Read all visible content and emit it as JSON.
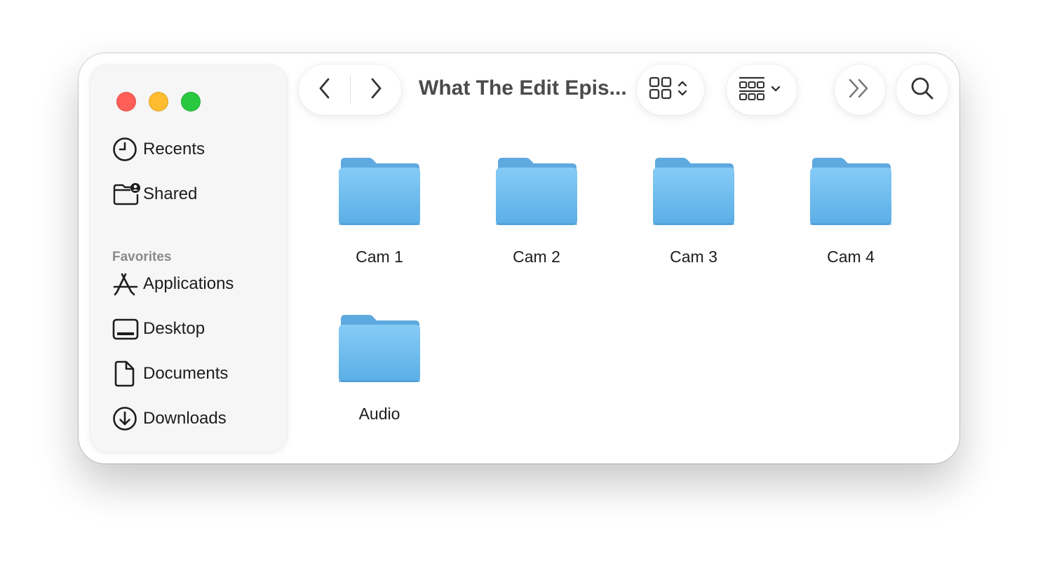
{
  "window": {
    "title": "What The Edit Epis..."
  },
  "sidebar": {
    "top_items": [
      {
        "label": "Recents",
        "icon": "clock-icon"
      },
      {
        "label": "Shared",
        "icon": "shared-folder-icon"
      }
    ],
    "favorites_heading": "Favorites",
    "favorites": [
      {
        "label": "Applications",
        "icon": "applications-icon"
      },
      {
        "label": "Desktop",
        "icon": "desktop-icon"
      },
      {
        "label": "Documents",
        "icon": "document-icon"
      },
      {
        "label": "Downloads",
        "icon": "download-icon"
      }
    ]
  },
  "toolbar": {
    "back_icon": "chevron-left-icon",
    "forward_icon": "chevron-right-icon",
    "view_icon": "grid-view-icon",
    "group_icon": "group-icon",
    "more_icon": "double-chevron-icon",
    "search_icon": "search-icon"
  },
  "files": [
    {
      "name": "Cam 1",
      "kind": "folder"
    },
    {
      "name": "Cam 2",
      "kind": "folder"
    },
    {
      "name": "Cam 3",
      "kind": "folder"
    },
    {
      "name": "Cam 4",
      "kind": "folder"
    },
    {
      "name": "Audio",
      "kind": "folder"
    }
  ],
  "colors": {
    "traffic_red": "#ff5f57",
    "traffic_yellow": "#febc2e",
    "traffic_green": "#28c840",
    "folder_blue": "#6bb9ef"
  }
}
